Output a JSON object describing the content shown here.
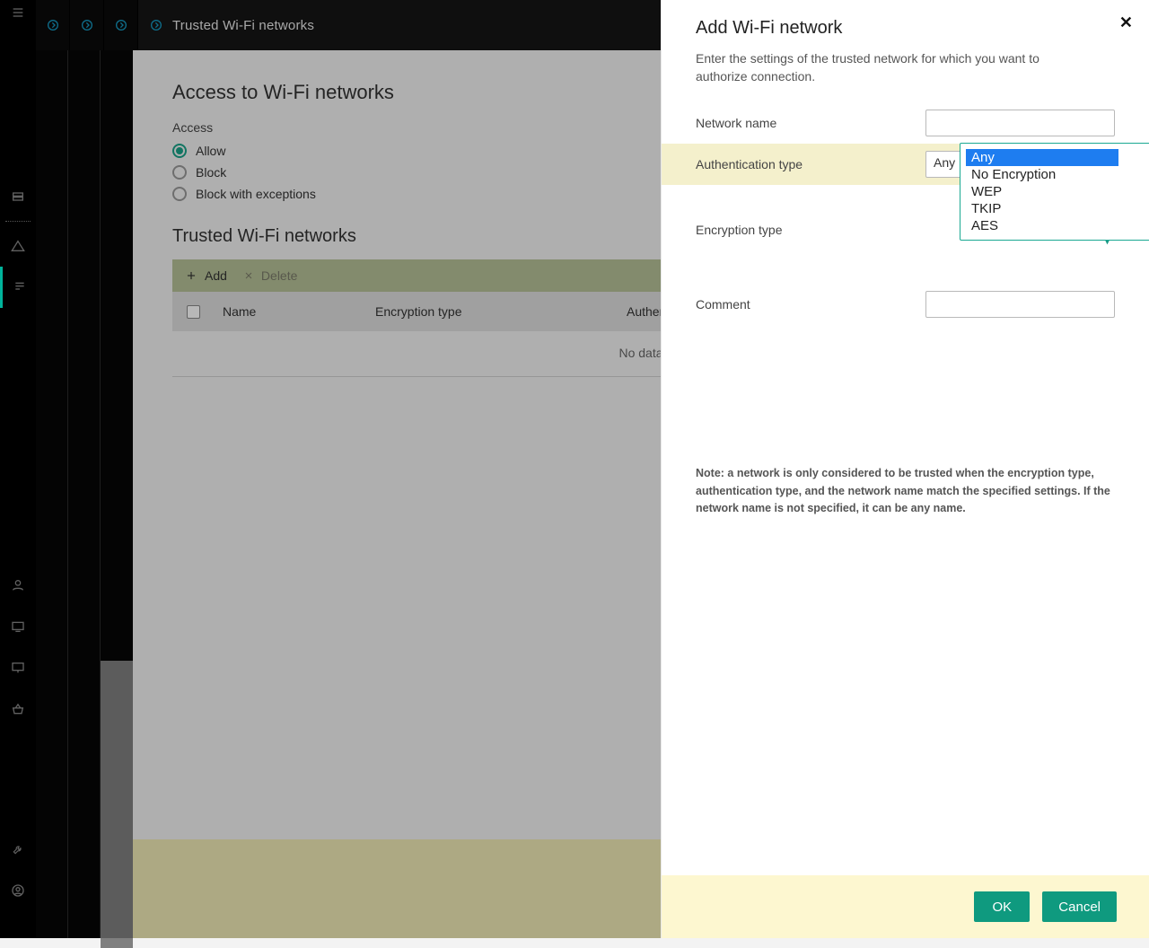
{
  "header": {
    "breadcrumb_title": "Trusted Wi-Fi networks"
  },
  "main": {
    "access_heading": "Access to Wi-Fi networks",
    "access_label": "Access",
    "radios": {
      "allow": "Allow",
      "block": "Block",
      "block_exceptions": "Block with exceptions"
    },
    "trusted_heading": "Trusted Wi-Fi networks",
    "toolbar": {
      "add": "Add",
      "delete": "Delete"
    },
    "table": {
      "col_name": "Name",
      "col_encryption": "Encryption type",
      "col_auth": "Authentication type",
      "no_data": "No data"
    }
  },
  "panel": {
    "title": "Add Wi-Fi network",
    "subtitle": "Enter the settings of the trusted network for which you want to authorize connection.",
    "labels": {
      "network_name": "Network name",
      "auth_type": "Authentication type",
      "encryption_type": "Encryption type",
      "comment": "Comment"
    },
    "values": {
      "network_name": "",
      "auth_type": "Any",
      "encryption_type": "",
      "comment": ""
    },
    "encryption_options": {
      "o1": "Any",
      "o2": "No Encryption",
      "o3": "WEP",
      "o4": "TKIP",
      "o5": "AES"
    },
    "note": "Note: a network is only considered to be trusted when the encryption type, authentication type, and the network name match the specified settings. If the network name is not specified, it can be any name.",
    "buttons": {
      "ok": "OK",
      "cancel": "Cancel"
    }
  }
}
